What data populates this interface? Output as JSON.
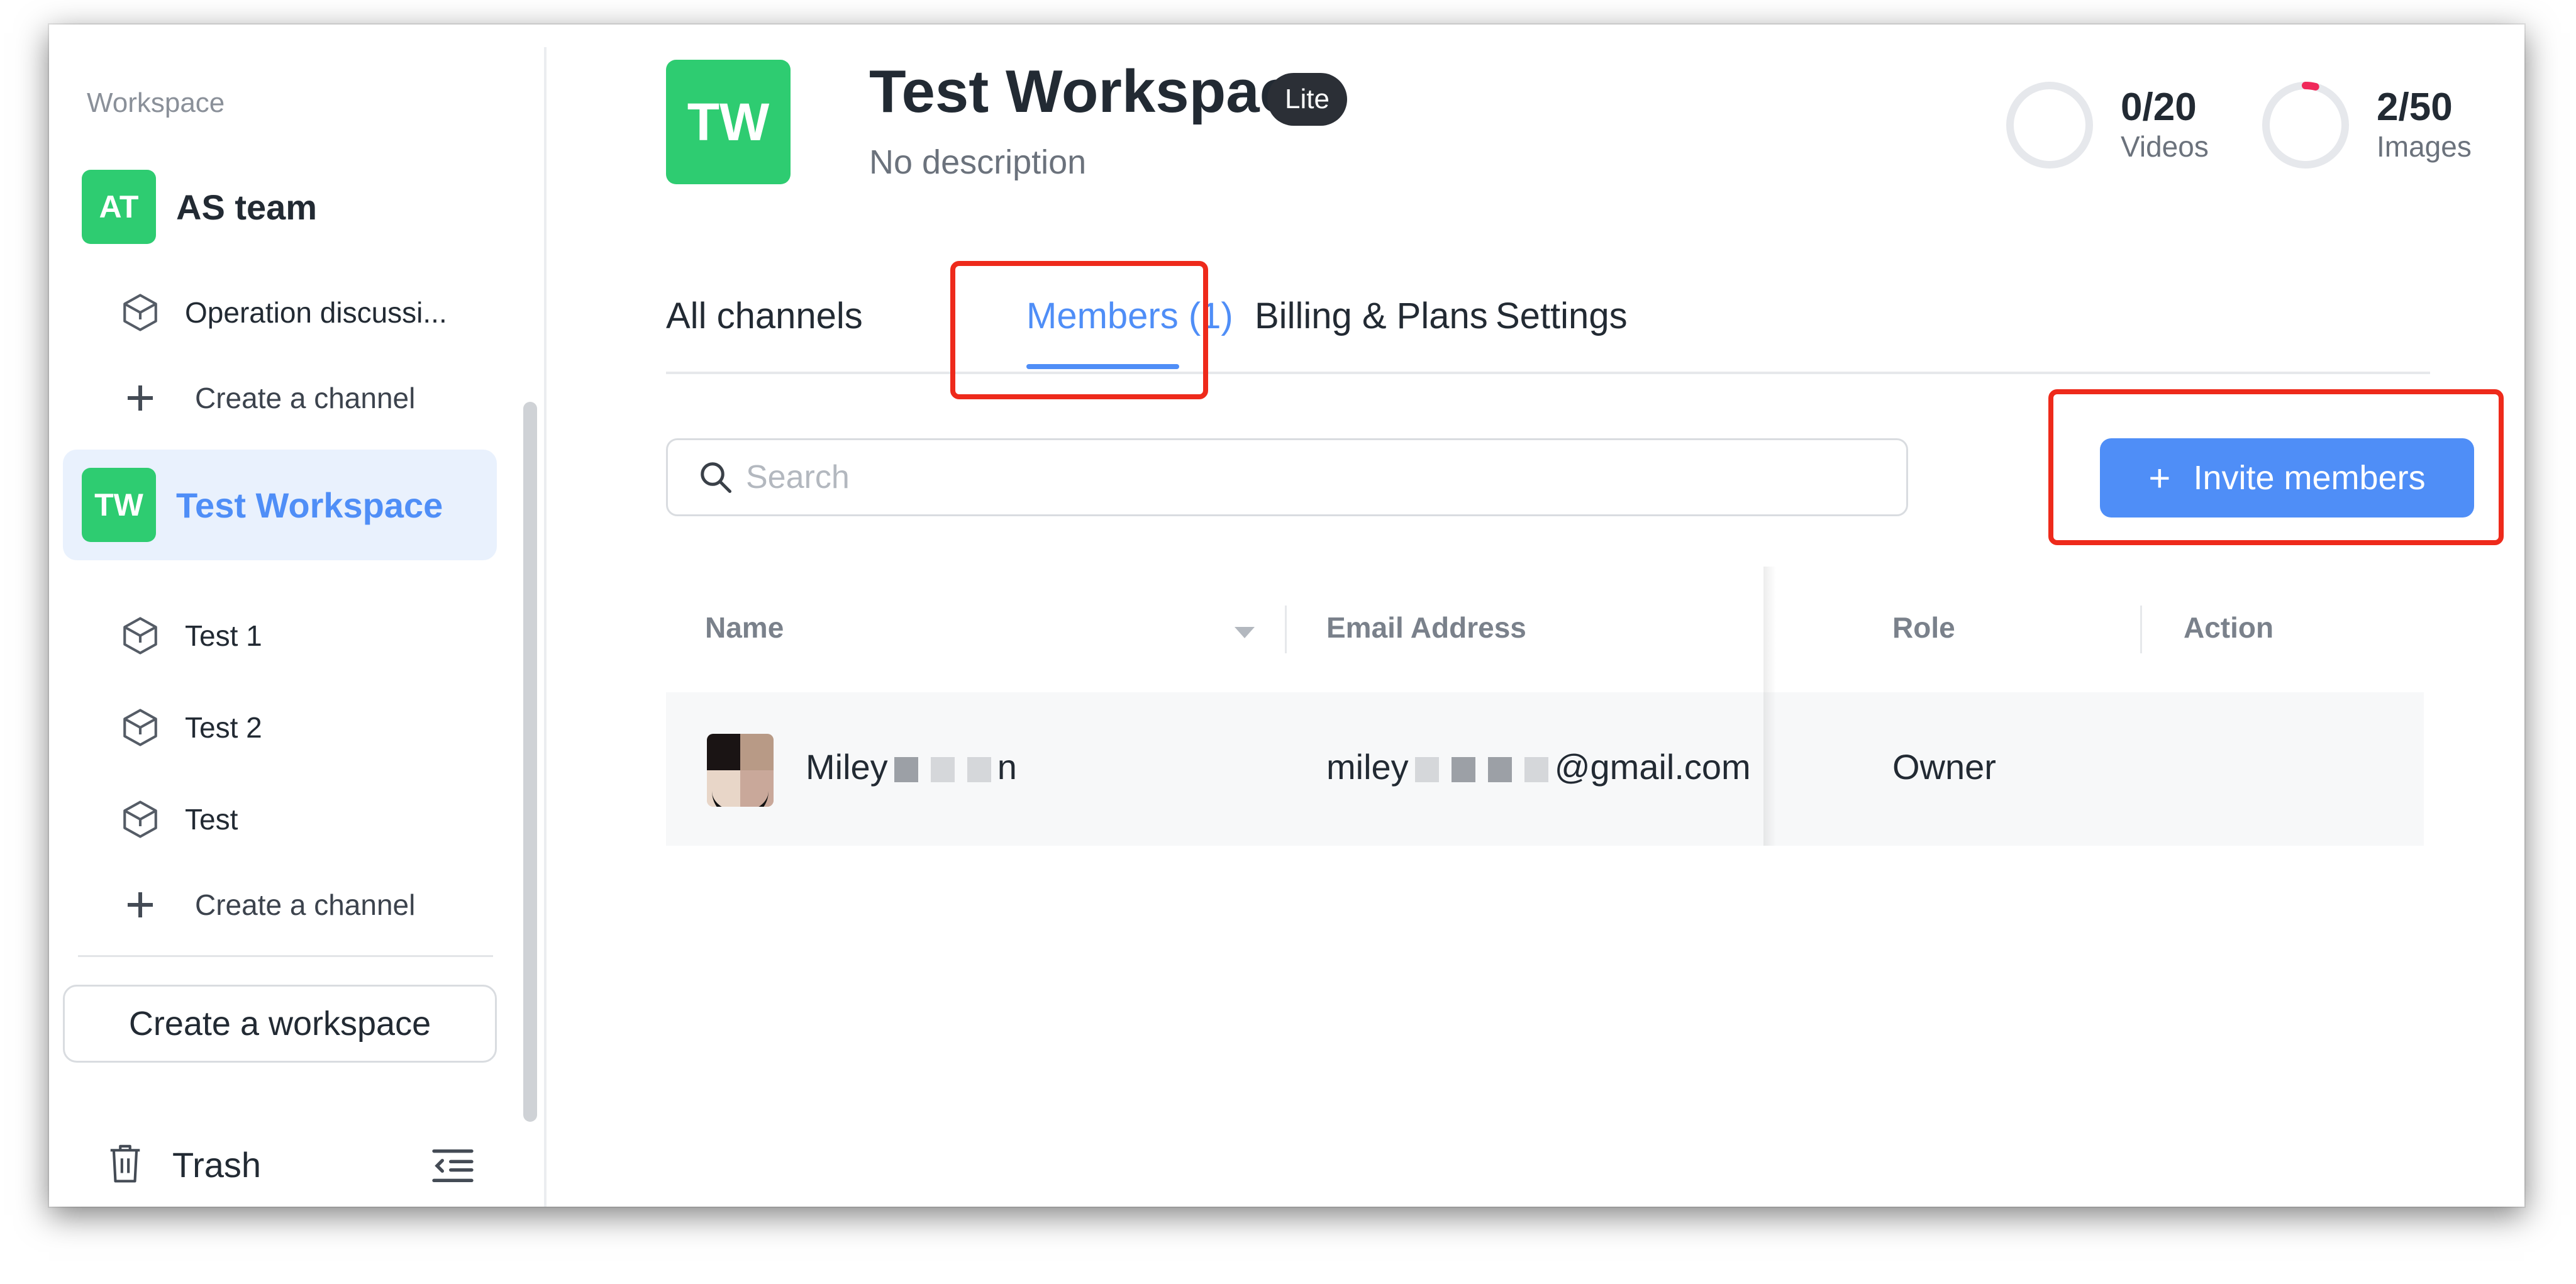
{
  "sidebar": {
    "section_label": "Workspace",
    "workspaces": [
      {
        "initials": "AT",
        "name": "AS team",
        "channels": [
          "Operation discussi..."
        ],
        "create_channel_label": "Create a channel"
      },
      {
        "initials": "TW",
        "name": "Test Workspace",
        "active": true,
        "channels": [
          "Test 1",
          "Test 2",
          "Test"
        ],
        "create_channel_label": "Create a channel"
      }
    ],
    "create_workspace_label": "Create a workspace",
    "trash_label": "Trash"
  },
  "header": {
    "avatar_initials": "TW",
    "title": "Test Workspace",
    "plan_badge": "Lite",
    "description": "No description",
    "quotas": [
      {
        "count": "0/20",
        "label": "Videos",
        "used_fraction": 0.0
      },
      {
        "count": "2/50",
        "label": "Images",
        "used_fraction": 0.04
      }
    ]
  },
  "tabs": [
    {
      "label": "All channels"
    },
    {
      "label": "Members (1)",
      "active": true
    },
    {
      "label": "Billing & Plans"
    },
    {
      "label": "Settings"
    }
  ],
  "search": {
    "placeholder": "Search",
    "value": ""
  },
  "invite_button": {
    "label": "Invite members",
    "icon": "plus-icon"
  },
  "table": {
    "columns": [
      "Name",
      "Email Address",
      "Role",
      "Action"
    ],
    "rows": [
      {
        "name_visible_prefix": "Miley",
        "name_visible_suffix": "n",
        "email_visible_prefix": "miley",
        "email_visible_suffix": "@gmail.com",
        "role": "Owner",
        "action": ""
      }
    ]
  },
  "colors": {
    "accent": "#4f8ef7",
    "avatar_green": "#2ecc71",
    "highlight_red": "#ee2a1b",
    "badge_dark": "#2b2f36"
  }
}
